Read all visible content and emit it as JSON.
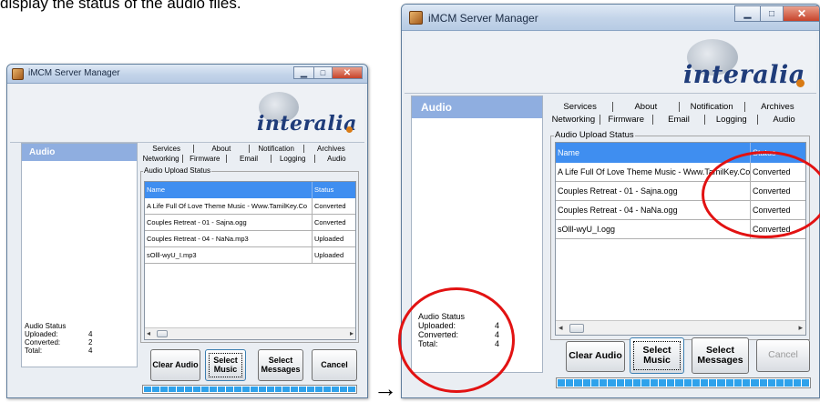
{
  "caption": "display the status of the audio files.",
  "windows": [
    {
      "title": "iMCM Server Manager",
      "logo": "interalia",
      "panel_title": "Audio",
      "tabs_row1": [
        "Services",
        "About",
        "Notification",
        "Archives"
      ],
      "tabs_row2": [
        "Networking",
        "Firmware",
        "Email",
        "Logging",
        "Audio"
      ],
      "group_label": "Audio Upload Status",
      "columns": [
        "Name",
        "Status"
      ],
      "rows": [
        [
          "A Life Full Of Love Theme Music - Www.TamilKey.Co",
          "Converted"
        ],
        [
          "Couples Retreat - 01 - Sajna.ogg",
          "Converted"
        ],
        [
          "Couples Retreat - 04 - NaNa.mp3",
          "Uploaded"
        ],
        [
          "sOlll-wyU_I.mp3",
          "Uploaded"
        ]
      ],
      "status": {
        "title": "Audio Status",
        "items": [
          {
            "label": "Uploaded:",
            "value": "4"
          },
          {
            "label": "Converted:",
            "value": "2"
          },
          {
            "label": "Total:",
            "value": "4"
          }
        ]
      },
      "buttons": {
        "clear": "Clear Audio",
        "select_music": "Select\nMusic",
        "select_messages": "Select\nMessages",
        "cancel": "Cancel"
      },
      "progress_fraction": 1.0
    },
    {
      "title": "iMCM Server Manager",
      "logo": "interalia",
      "panel_title": "Audio",
      "tabs_row1": [
        "Services",
        "About",
        "Notification",
        "Archives"
      ],
      "tabs_row2": [
        "Networking",
        "Firmware",
        "Email",
        "Logging",
        "Audio"
      ],
      "group_label": "Audio Upload Status",
      "columns": [
        "Name",
        "Status"
      ],
      "rows": [
        [
          "A Life Full Of Love Theme Music - Www.TamilKey.Co",
          "Converted"
        ],
        [
          "Couples Retreat - 01 - Sajna.ogg",
          "Converted"
        ],
        [
          "Couples Retreat - 04 - NaNa.ogg",
          "Converted"
        ],
        [
          "sOlll-wyU_I.ogg",
          "Converted"
        ]
      ],
      "status": {
        "title": "Audio Status",
        "items": [
          {
            "label": "Uploaded:",
            "value": "4"
          },
          {
            "label": "Converted:",
            "value": "4"
          },
          {
            "label": "Total:",
            "value": "4"
          }
        ]
      },
      "buttons": {
        "clear": "Clear Audio",
        "select_music": "Select\nMusic",
        "select_messages": "Select\nMessages",
        "cancel": "Cancel"
      },
      "progress_fraction": 1.0
    }
  ],
  "annotation_arrow": "→",
  "colors": {
    "header_blue": "#3f8ef0",
    "panel_header": "#8faee0",
    "progress": "#2fa2eb",
    "highlight_ellipse": "#e21212"
  }
}
